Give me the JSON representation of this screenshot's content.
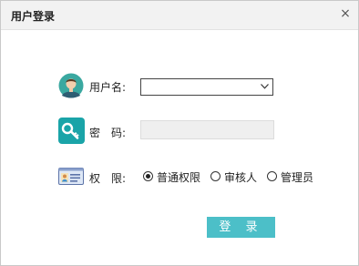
{
  "dialog": {
    "title": "用户登录",
    "close_symbol": "×"
  },
  "form": {
    "username": {
      "label": "用户名:",
      "value": "",
      "icon": "user-avatar-icon"
    },
    "password": {
      "label": "密　码:",
      "value": "",
      "icon": "key-icon"
    },
    "role": {
      "label": "权　限:",
      "icon": "id-card-icon",
      "options": [
        {
          "label": "普通权限",
          "selected": true
        },
        {
          "label": "审核人",
          "selected": false
        },
        {
          "label": "管理员",
          "selected": false
        }
      ]
    },
    "login_button": "登 录"
  },
  "colors": {
    "accent": "#4cbfc8",
    "key_icon_bg": "#1aa4a8",
    "avatar_bg": "#3aa8a0",
    "titlebar_bg": "#f2f2f2"
  }
}
